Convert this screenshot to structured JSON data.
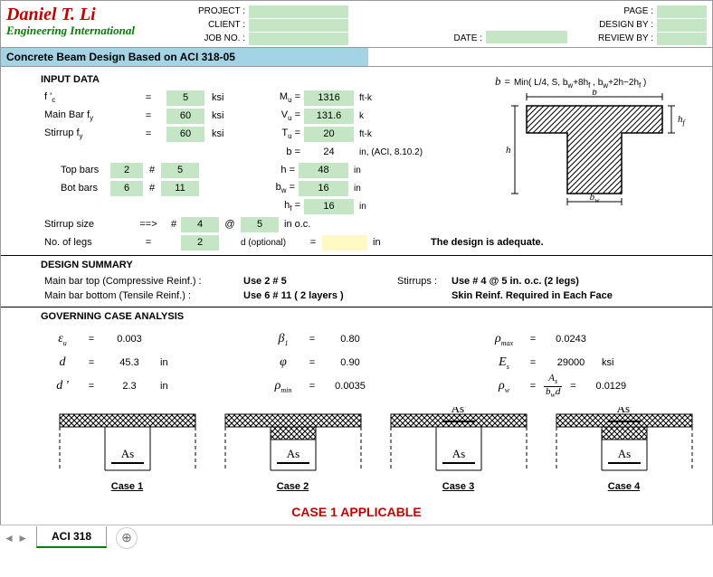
{
  "header": {
    "logo_title": "Daniel T. Li",
    "logo_sub": "Engineering International",
    "project_lbl": "PROJECT :",
    "client_lbl": "CLIENT :",
    "jobno_lbl": "JOB NO. :",
    "date_lbl": "DATE :",
    "page_lbl": "PAGE :",
    "designby_lbl": "DESIGN BY :",
    "reviewby_lbl": "REVIEW BY :",
    "project": "",
    "client": "",
    "jobno": "",
    "date": "",
    "page": "",
    "designby": "",
    "reviewby": ""
  },
  "title": "Concrete Beam Design Based on ACI 318-05",
  "sect": {
    "input": "INPUT DATA",
    "summary": "DESIGN SUMMARY",
    "gov": "GOVERNING CASE ANALYSIS"
  },
  "inputs": {
    "fc_lbl": "f 'c",
    "fc": "5",
    "fc_unit": "ksi",
    "fy_lbl": "Main Bar fy",
    "fy": "60",
    "fy_unit": "ksi",
    "fyv_lbl": "Stirrup fy",
    "fyv": "60",
    "fyv_unit": "ksi",
    "top_lbl": "Top bars",
    "top_n": "2",
    "top_size": "5",
    "bot_lbl": "Bot bars",
    "bot_n": "6",
    "bot_size": "11",
    "stir_lbl": "Stirrup size",
    "stir_arrow": "==>",
    "stir_size": "4",
    "stir_sp": "5",
    "stir_unit": "in o.c.",
    "legs_lbl": "No. of legs",
    "legs": "2",
    "d_opt_lbl": "d (optional)",
    "d_opt": "",
    "d_opt_unit": "in",
    "mu_lbl": "Mu =",
    "mu": "1316",
    "mu_unit": "ft-k",
    "vu_lbl": "Vu =",
    "vu": "131.6",
    "vu_unit": "k",
    "tu_lbl": "Tu =",
    "tu": "20",
    "tu_unit": "ft-k",
    "b_lbl": "b =",
    "b": "24",
    "b_unit": "in, (ACI, 8.10.2)",
    "h_lbl": "h =",
    "h": "48",
    "h_unit": "in",
    "bw_lbl": "bw =",
    "bw": "16",
    "bw_unit": "in",
    "hf_lbl": "hf =",
    "hf": "16",
    "hf_unit": "in",
    "hash": "#",
    "at": "@",
    "eq": "="
  },
  "formula": {
    "b": "b",
    "eq": "=",
    "expr": "Min( L/4, S, bw+8hf , bw+2h−2hf )"
  },
  "adequate": "The design is adequate.",
  "summary": {
    "top_lbl": "Main bar top (Compressive Reinf.) :",
    "top_use": "Use  2 # 5",
    "bot_lbl": "Main bar bottom (Tensile Reinf.) :",
    "bot_use": "Use  6 # 11 ( 2 layers )",
    "stir_lbl": "Stirrups :",
    "stir_use": "Use # 4 @ 5 in. o.c.  (2 legs)",
    "skin": "Skin Reinf. Required in Each Face"
  },
  "gov": {
    "eu_sym": "εu",
    "eu": "0.003",
    "d_sym": "d",
    "d": "45.3",
    "d_unit": "in",
    "dp_sym": "d '",
    "dp": "2.3",
    "dp_unit": "in",
    "b1_sym": "β1",
    "b1": "0.80",
    "phi_sym": "φ",
    "phi": "0.90",
    "pmin_sym": "ρmin",
    "pmin": "0.0035",
    "pmax_sym": "ρmax",
    "pmax": "0.0243",
    "es_sym": "Es",
    "es": "29000",
    "es_unit": "ksi",
    "pw_sym": "ρw",
    "pw_frac_num": "As",
    "pw_frac_den": "bwd",
    "pw": "0.0129",
    "eq": "="
  },
  "cases": {
    "as": "As",
    "asp": "As'",
    "c1": "Case 1",
    "c2": "Case 2",
    "c3": "Case 3",
    "c4": "Case 4"
  },
  "applicable": "CASE 1  APPLICABLE",
  "tabs": {
    "tab1": "ACI 318"
  }
}
